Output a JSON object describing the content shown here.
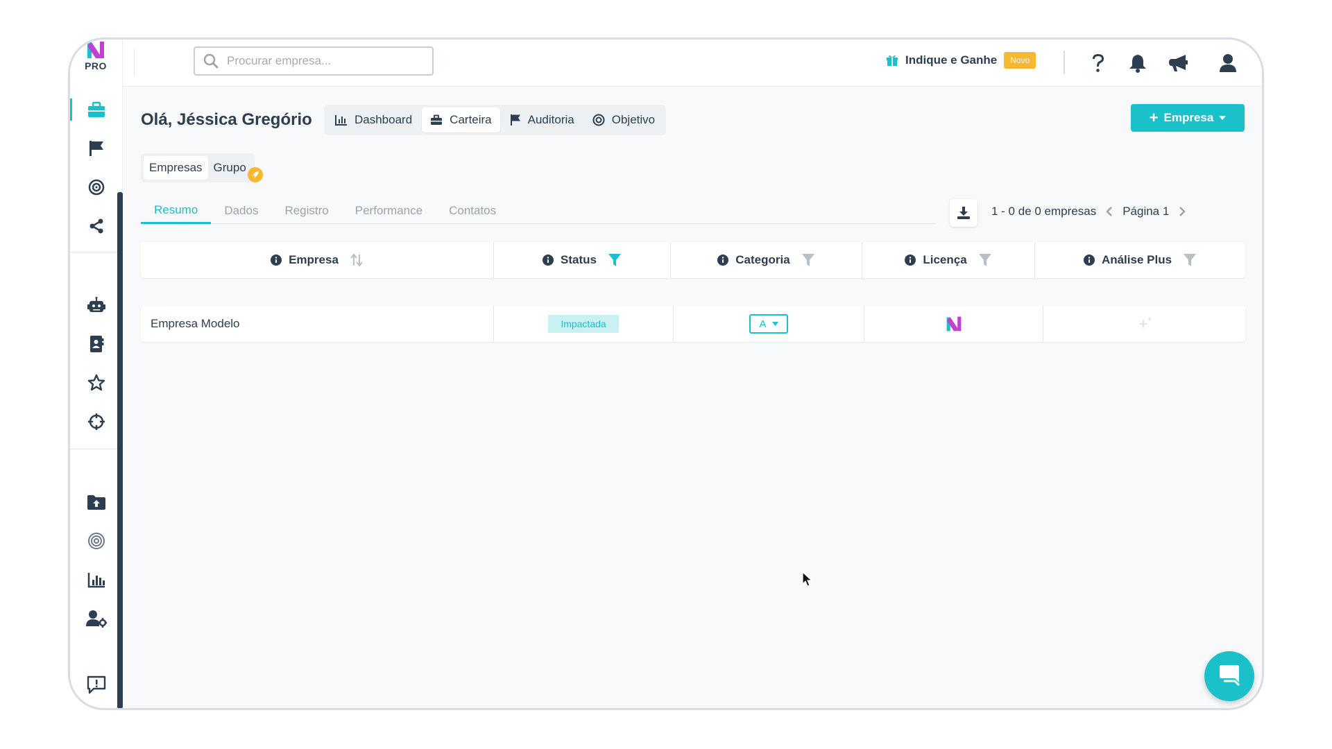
{
  "brand": {
    "plan": "PRO"
  },
  "search": {
    "placeholder": "Procurar empresa..."
  },
  "header": {
    "referral_label": "Indique e Ganhe",
    "referral_badge": "Novo",
    "icons": [
      "question-icon",
      "bell-icon",
      "megaphone-icon",
      "user-icon"
    ]
  },
  "sidebar": {
    "items": [
      "briefcase-icon",
      "flag-icon",
      "target-icon",
      "share-icon",
      "robot-icon",
      "contact-book-icon",
      "star-icon",
      "crosshair-icon",
      "folder-upload-icon",
      "radar-icon",
      "bar-chart-icon",
      "user-settings-icon",
      "feedback-icon"
    ],
    "active": "briefcase-icon"
  },
  "page": {
    "greeting": "Olá, Jéssica Gregório",
    "tabs": [
      {
        "label": "Dashboard",
        "icon": "chart-icon"
      },
      {
        "label": "Carteira",
        "icon": "briefcase-icon"
      },
      {
        "label": "Auditoria",
        "icon": "flag-icon"
      },
      {
        "label": "Objetivo",
        "icon": "target-icon"
      }
    ],
    "active_tab": "Carteira",
    "add_button": "Empresa"
  },
  "toggle": {
    "items": [
      "Empresas",
      "Grupo"
    ],
    "active": "Empresas"
  },
  "view_tabs": {
    "items": [
      "Resumo",
      "Dados",
      "Registro",
      "Performance",
      "Contatos"
    ],
    "active": "Resumo"
  },
  "pagination": {
    "summary": "1 - 0 de 0 empresas",
    "page_label": "Página 1"
  },
  "table": {
    "columns": [
      "Empresa",
      "Status",
      "Categoria",
      "Licença",
      "Análise Plus"
    ],
    "rows": [
      {
        "empresa": "Empresa Modelo",
        "status": "Impactada",
        "categoria": "A",
        "licenca": "brand-logo-icon",
        "analise_plus": "sparkle-icon"
      }
    ]
  },
  "colors": {
    "accent": "#1ac1c8",
    "dark": "#2c3e50",
    "badge": "#f7b731",
    "status_bg": "#c9f1f1"
  }
}
